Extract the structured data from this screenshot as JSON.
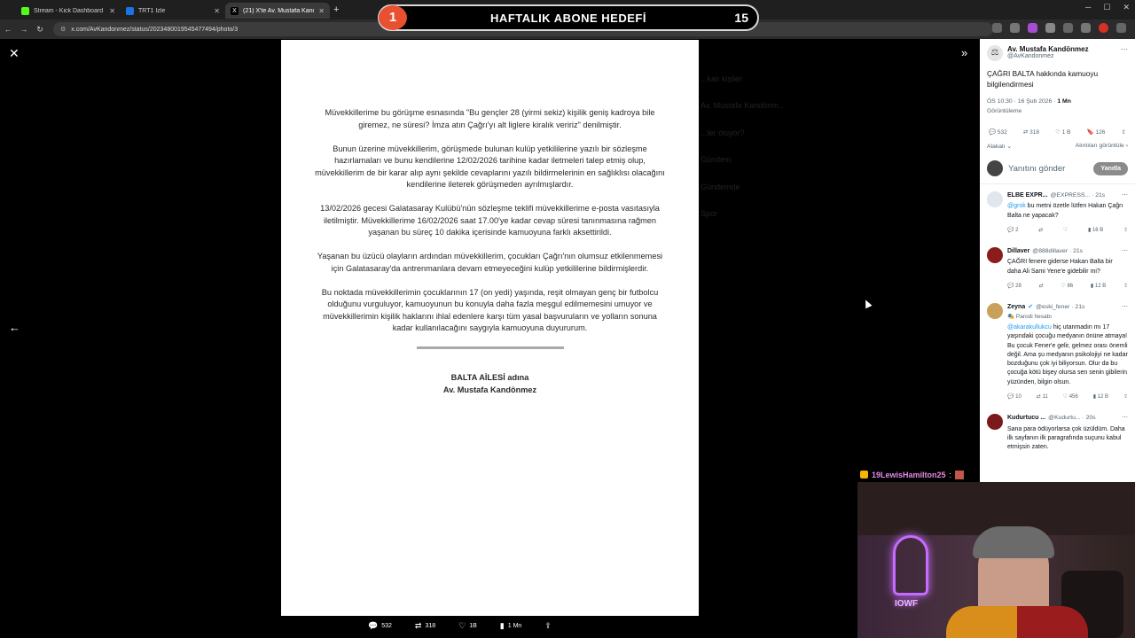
{
  "browser": {
    "tabs": [
      {
        "label": "Stream - Kick Dashboard",
        "color": "#53fc18"
      },
      {
        "label": "TRT1 İzle",
        "color": "#1a73e8"
      },
      {
        "label": "(21) X'te Av. Mustafa Kandönm...",
        "color": "#ffffff"
      }
    ],
    "url": "x.com/AvKandonmez/status/2023480019545477494/photo/3"
  },
  "banner": {
    "badge": "1",
    "title": "HAFTALIK ABONE HEDEFİ",
    "count": "15"
  },
  "document": {
    "paragraphs": [
      "Müvekkillerime bu görüşme esnasında \"Bu gençler 28 (yirmi sekiz) kişilik geniş kadroya bile giremez, ne süresi? İmza atın Çağrı'yı alt liglere kiralık veririz\" denilmiştir.",
      "Bunun üzerine müvekkillerim, görüşmede bulunan kulüp yetkililerine yazılı bir sözleşme hazırlamaları ve bunu kendilerine 12/02/2026 tarihine kadar iletmeleri talep etmiş olup, müvekkillerim de bir karar alıp aynı şekilde cevaplarını yazılı bildirmelerinin en sağlıklısı olacağını kendilerine ileterek görüşmeden ayrılmışlardır.",
      "13/02/2026 gecesi Galatasaray Kulübü'nün sözleşme teklifi müvekkillerime e-posta vasıtasıyla iletilmiştir. Müvekkillerime 16/02/2026 saat 17.00'ye kadar cevap süresi tanınmasına rağmen yaşanan bu süreç 10 dakika içerisinde kamuoyuna farklı aksettirildi.",
      "Yaşanan bu üzücü olayların ardından müvekkillerim, çocukları Çağrı'nın olumsuz etkilenmemesi için Galatasaray'da antrenmanlara devam etmeyeceğini kulüp yetkililerine bildirmişlerdir.",
      "Bu noktada müvekkillerimin çocuklarının 17 (on yedi) yaşında, reşit olmayan genç bir futbolcu olduğunu vurguluyor, kamuoyunun bu konuyla daha fazla meşgul edilmemesini umuyor ve müvekkillerimin kişilik haklarını ihlal edenlere karşı tüm yasal başvuruların ve yolların sonuna kadar kullanılacağını saygıyla kamuoyuna duyururum."
    ],
    "signature_line1": "BALTA AİLESİ adına",
    "signature_line2": "Av. Mustafa Kandönmez"
  },
  "bottom_stats": {
    "replies": "532",
    "reposts": "318",
    "likes": "1B",
    "views": "1 Mn"
  },
  "background_ghost": [
    "...kalı kişiler",
    "Av. Mustafa Kandönm...",
    "...ler oluyor?",
    "Gündem",
    "Gündemde",
    "Spor"
  ],
  "panel": {
    "author_name": "Av. Mustafa Kandönmez",
    "author_handle": "@AvKandonmez",
    "tweet_text": "ÇAĞRI BALTA hakkında kamuoyu bilgilendirmesi",
    "time": "ÖS 10:30 · 16 Şub 2026 · ",
    "views_count": "1 Mn",
    "views_label": "Görüntüleme",
    "actions": {
      "replies": "532",
      "reposts": "318",
      "likes": "1 B",
      "bookmarks": "126"
    },
    "sort_label": "Alakalı",
    "quotes_label": "Alıntıları görüntüle",
    "reply_placeholder": "Yanıtını gönder",
    "reply_button": "Yanıtla",
    "replies": [
      {
        "name": "ELBE EXPR...",
        "handle": "@EXPRESS... · 21s",
        "mention": "@grok",
        "text": " bu metni özetle lütfen Hakan Çağrı Balta ne yapacak?",
        "acts": [
          "2",
          "",
          "",
          "16 B"
        ],
        "avatar_color": "#dfe6ee"
      },
      {
        "name": "Dillaver",
        "handle": "@888dillaver · 21s",
        "mention": "",
        "text": "ÇAĞRI fenere giderse Hakan Balta bir daha Ali Sami Yene'e gidebilir mi?",
        "acts": [
          "28",
          "",
          "86",
          "12 B"
        ],
        "avatar_color": "#8a1c1c"
      },
      {
        "name": "Zeyna",
        "handle": "@eski_fener · 21s",
        "parody": "Parodi hesabı",
        "mention": "@akarakullukcu",
        "text": " hiç utanmadın mı 17 yaşındaki çocuğu medyanın önüne atmaya! Bu çocuk Fener'e gelir, gelmez orası önemli değil. Ama şu medyanın psikolojiyi ne kadar bozduğunu çok iyi biliyorsun. Olur da bu çocuğa kötü bişey olursa sen senin gibilerin yüzünden, bilgin olsun.",
        "acts": [
          "10",
          "11",
          "456",
          "12 B"
        ],
        "avatar_color": "#c9a15a"
      },
      {
        "name": "Kudurtucu ...",
        "handle": "@Kudurtu... · 20s",
        "mention": "",
        "text": "Sana para ödüyorlarsa çok üzüldüm. Daha ilk sayfanın ilk paragrafında suçunu kabul etmişsin zaten.",
        "acts": [
          "",
          "",
          "",
          ""
        ],
        "avatar_color": "#7a1a1a"
      }
    ]
  },
  "chat": {
    "username": "19LewisHamilton25",
    "separator": ":"
  },
  "webcam": {
    "neon_text": "IOWF"
  }
}
